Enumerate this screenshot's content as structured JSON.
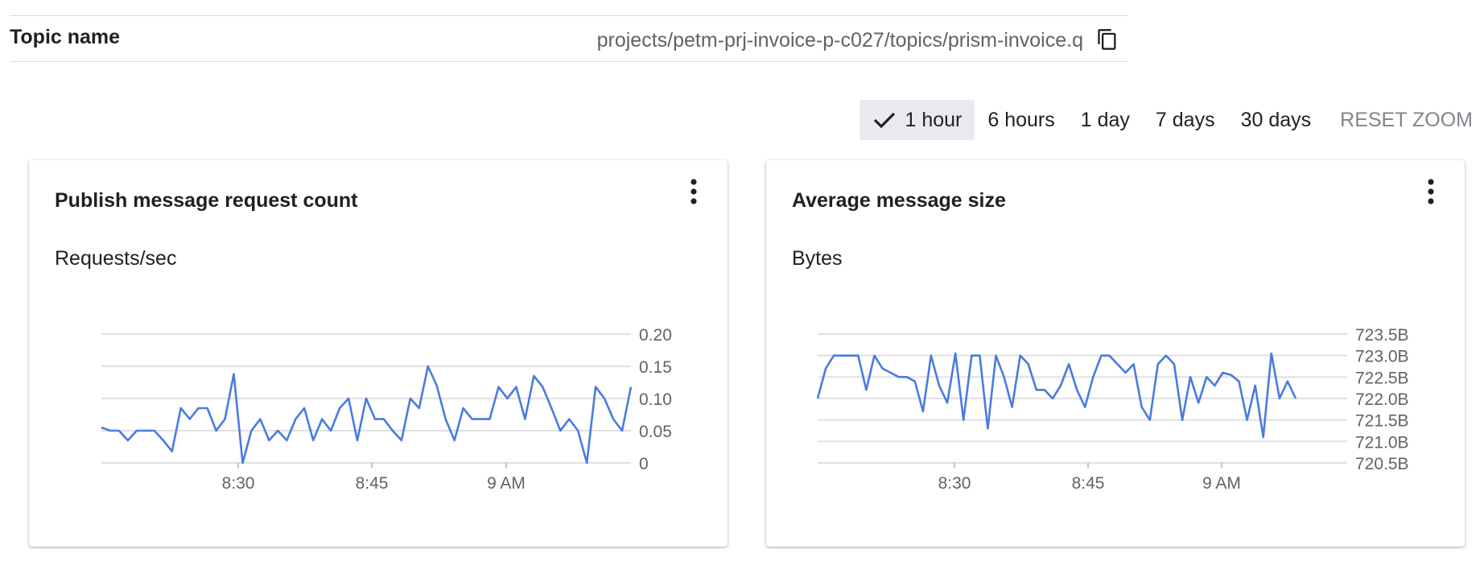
{
  "topic": {
    "label": "Topic name",
    "value": "projects/petm-prj-invoice-p-c027/topics/prism-invoice.q",
    "copy_icon": "copy-icon"
  },
  "time_range": {
    "options": [
      "1 hour",
      "6 hours",
      "1 day",
      "7 days",
      "30 days"
    ],
    "selected": "1 hour",
    "reset_label": "RESET ZOOM"
  },
  "colors": {
    "line": "#4a7be0",
    "grid": "#e0e0e0",
    "selected_bg": "#e8eaed"
  },
  "cards": [
    {
      "title": "Publish message request count",
      "unit": "Requests/sec",
      "menu_icon": "more-vert-icon"
    },
    {
      "title": "Average message size",
      "unit": "Bytes",
      "menu_icon": "more-vert-icon"
    }
  ],
  "chart_data": [
    {
      "type": "line",
      "title": "Publish message request count",
      "ylabel": "Requests/sec",
      "y_axis_side": "right",
      "ylim": [
        0,
        0.2
      ],
      "y_ticks": [
        0,
        0.05,
        0.1,
        0.15,
        0.2
      ],
      "y_tick_labels": [
        "0",
        "0.05",
        "0.10",
        "0.15",
        "0.20"
      ],
      "x_tick_labels": [
        "8:30",
        "8:45",
        "9 AM"
      ],
      "grid": true,
      "series": [
        {
          "values": [
            0.055,
            0.05,
            0.05,
            0.035,
            0.05,
            0.05,
            0.05,
            0.035,
            0.018,
            0.085,
            0.068,
            0.085,
            0.085,
            0.05,
            0.068,
            0.138,
            0.0,
            0.05,
            0.068,
            0.035,
            0.05,
            0.035,
            0.068,
            0.085,
            0.035,
            0.068,
            0.05,
            0.085,
            0.1,
            0.035,
            0.1,
            0.068,
            0.068,
            0.05,
            0.035,
            0.1,
            0.085,
            0.15,
            0.12,
            0.068,
            0.035,
            0.085,
            0.068,
            0.068,
            0.068,
            0.118,
            0.1,
            0.118,
            0.068,
            0.135,
            0.118,
            0.085,
            0.05,
            0.068,
            0.05,
            0.0,
            0.118,
            0.1,
            0.068,
            0.05,
            0.118
          ]
        }
      ]
    },
    {
      "type": "line",
      "title": "Average message size",
      "ylabel": "Bytes",
      "y_axis_side": "right",
      "ylim": [
        720.5,
        723.5
      ],
      "y_ticks": [
        720.5,
        721.0,
        721.5,
        722.0,
        722.5,
        723.0,
        723.5
      ],
      "y_tick_labels": [
        "720.5B",
        "721.0B",
        "721.5B",
        "722.0B",
        "722.5B",
        "723.0B",
        "723.5B"
      ],
      "x_tick_labels": [
        "8:30",
        "8:45",
        "9 AM"
      ],
      "grid": true,
      "series": [
        {
          "values": [
            722.0,
            722.7,
            723.0,
            723.0,
            723.0,
            723.0,
            722.2,
            723.0,
            722.7,
            722.6,
            722.5,
            722.5,
            722.4,
            721.7,
            723.0,
            722.3,
            721.9,
            723.05,
            721.5,
            723.0,
            723.0,
            721.3,
            723.0,
            722.5,
            721.8,
            723.0,
            722.8,
            722.2,
            722.2,
            722.0,
            722.3,
            722.8,
            722.2,
            721.8,
            722.5,
            723.0,
            723.0,
            722.8,
            722.6,
            722.8,
            721.8,
            721.5,
            722.8,
            723.0,
            722.8,
            721.5,
            722.5,
            721.9,
            722.5,
            722.3,
            722.6,
            722.55,
            722.4,
            721.5,
            722.3,
            721.1,
            723.05,
            722.0,
            722.4,
            722.0
          ]
        }
      ]
    }
  ]
}
